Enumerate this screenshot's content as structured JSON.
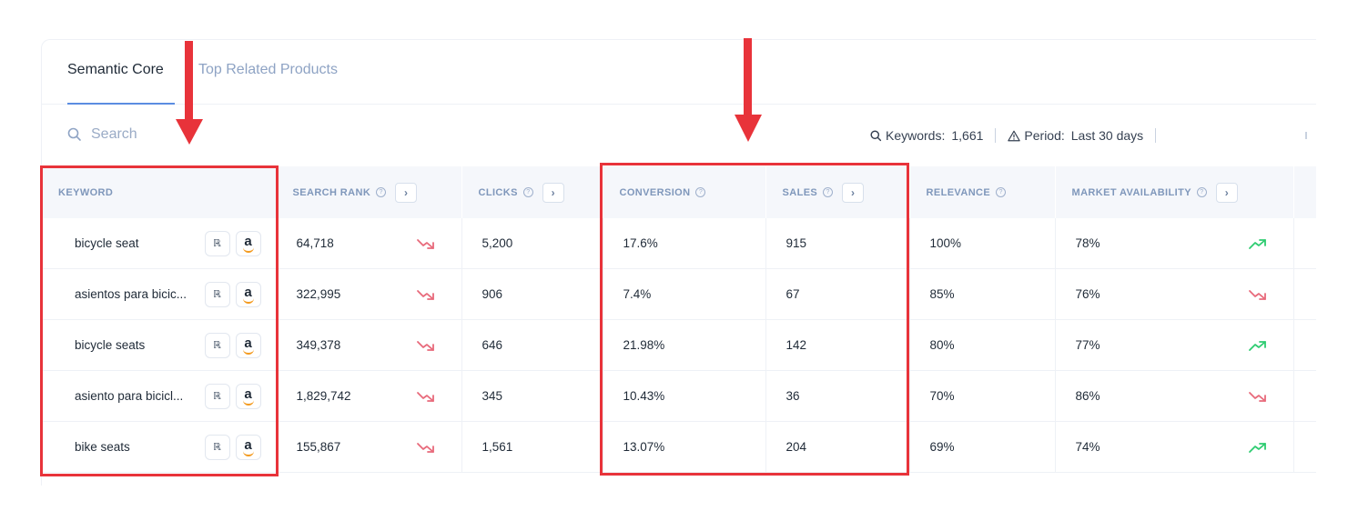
{
  "tabs": [
    {
      "label": "Semantic Core"
    },
    {
      "label": "Top Related Products"
    }
  ],
  "search": {
    "placeholder": "Search"
  },
  "stats": {
    "keywords_label": "Keywords:",
    "keywords_value": "1,661",
    "period_label": "Period:",
    "period_value": "Last 30 days"
  },
  "columns": [
    {
      "label": "KEYWORD",
      "help": false,
      "expand": false
    },
    {
      "label": "SEARCH RANK",
      "help": true,
      "expand": true
    },
    {
      "label": "CLICKS",
      "help": true,
      "expand": true
    },
    {
      "label": "CONVERSION",
      "help": true,
      "expand": false
    },
    {
      "label": "SALES",
      "help": true,
      "expand": true
    },
    {
      "label": "RELEVANCE",
      "help": true,
      "expand": false
    },
    {
      "label": "MARKET AVAILABILITY",
      "help": true,
      "expand": true
    }
  ],
  "rows": [
    {
      "keyword": "bicycle seat",
      "search_rank": "64,718",
      "rank_trend": "down",
      "clicks": "5,200",
      "conversion": "17.6%",
      "sales": "915",
      "relevance": "100%",
      "market_availability": "78%",
      "market_trend": "up"
    },
    {
      "keyword": "asientos para bicic...",
      "search_rank": "322,995",
      "rank_trend": "down",
      "clicks": "906",
      "conversion": "7.4%",
      "sales": "67",
      "relevance": "85%",
      "market_availability": "76%",
      "market_trend": "down"
    },
    {
      "keyword": "bicycle seats",
      "search_rank": "349,378",
      "rank_trend": "down",
      "clicks": "646",
      "conversion": "21.98%",
      "sales": "142",
      "relevance": "80%",
      "market_availability": "77%",
      "market_trend": "up"
    },
    {
      "keyword": "asiento para bicicl...",
      "search_rank": "1,829,742",
      "rank_trend": "down",
      "clicks": "345",
      "conversion": "10.43%",
      "sales": "36",
      "relevance": "70%",
      "market_availability": "86%",
      "market_trend": "down"
    },
    {
      "keyword": "bike seats",
      "search_rank": "155,867",
      "rank_trend": "down",
      "clicks": "1,561",
      "conversion": "13.07%",
      "sales": "204",
      "relevance": "69%",
      "market_availability": "74%",
      "market_trend": "up"
    }
  ],
  "icons": {
    "search": "search-icon",
    "keywords": "magnifier-icon",
    "period": "warning-triangle-icon",
    "help": "question-circle-icon",
    "expand": "chevron-right-icon",
    "reverse_search": "reverse-search-icon",
    "amazon": "amazon-logo-icon",
    "trend_down": "trend-down-icon",
    "trend_up": "trend-up-icon"
  },
  "colors": {
    "accent": "#5b8de1",
    "trend_down": "#e86a7b",
    "trend_up": "#2ecc71",
    "annotation": "#e8333a",
    "header_text": "#7f97bb"
  }
}
